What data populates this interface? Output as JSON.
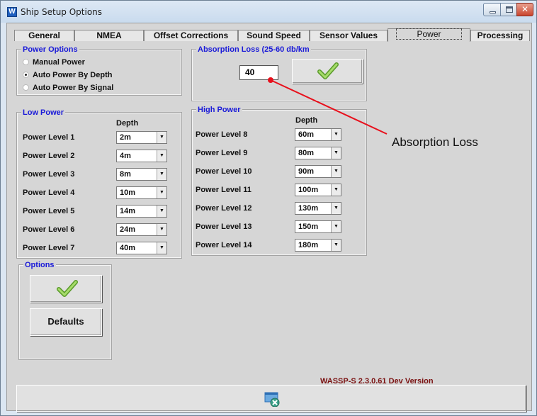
{
  "window": {
    "title": "Ship Setup Options",
    "app_icon_letter": "W"
  },
  "tabs": [
    {
      "label": "General"
    },
    {
      "label": "NMEA"
    },
    {
      "label": "Offset Corrections"
    },
    {
      "label": "Sound Speed"
    },
    {
      "label": "Sensor Values"
    },
    {
      "label": "Power",
      "active": true
    },
    {
      "label": "Processing"
    }
  ],
  "power_options": {
    "title": "Power Options",
    "options": [
      {
        "label": "Manual Power",
        "checked": false
      },
      {
        "label": "Auto Power By Depth",
        "checked": true
      },
      {
        "label": "Auto Power By Signal",
        "checked": false
      }
    ]
  },
  "absorption": {
    "title": "Absorption Loss (25-60 db/km",
    "value": "40",
    "apply_icon": "checkmark-icon"
  },
  "low_power": {
    "title": "Low Power",
    "depth_header": "Depth",
    "levels": [
      {
        "label": "Power Level 1",
        "depth": "2m"
      },
      {
        "label": "Power Level 2",
        "depth": "4m"
      },
      {
        "label": "Power Level 3",
        "depth": "8m"
      },
      {
        "label": "Power Level 4",
        "depth": "10m"
      },
      {
        "label": "Power Level 5",
        "depth": "14m"
      },
      {
        "label": "Power Level 6",
        "depth": "24m"
      },
      {
        "label": "Power Level 7",
        "depth": "40m"
      }
    ]
  },
  "high_power": {
    "title": "High Power",
    "depth_header": "Depth",
    "levels": [
      {
        "label": "Power Level 8",
        "depth": "60m"
      },
      {
        "label": "Power Level 9",
        "depth": "80m"
      },
      {
        "label": "Power Level 10",
        "depth": "90m"
      },
      {
        "label": "Power Level 11",
        "depth": "100m"
      },
      {
        "label": "Power Level 12",
        "depth": "130m"
      },
      {
        "label": "Power Level 13",
        "depth": "150m"
      },
      {
        "label": "Power Level 14",
        "depth": "180m"
      }
    ]
  },
  "options": {
    "title": "Options",
    "apply_icon": "checkmark-icon",
    "defaults_label": "Defaults"
  },
  "annotation": {
    "label": "Absorption Loss",
    "color": "#e8101c"
  },
  "status": {
    "version": "WASSP-S 2.3.0.61 Dev Version"
  },
  "bottom_bar": {
    "close_icon": "close-window-icon"
  },
  "colors": {
    "group_title": "#1a1ad8",
    "client_bg": "#d6d6d6",
    "check_green": "#7ac043"
  }
}
